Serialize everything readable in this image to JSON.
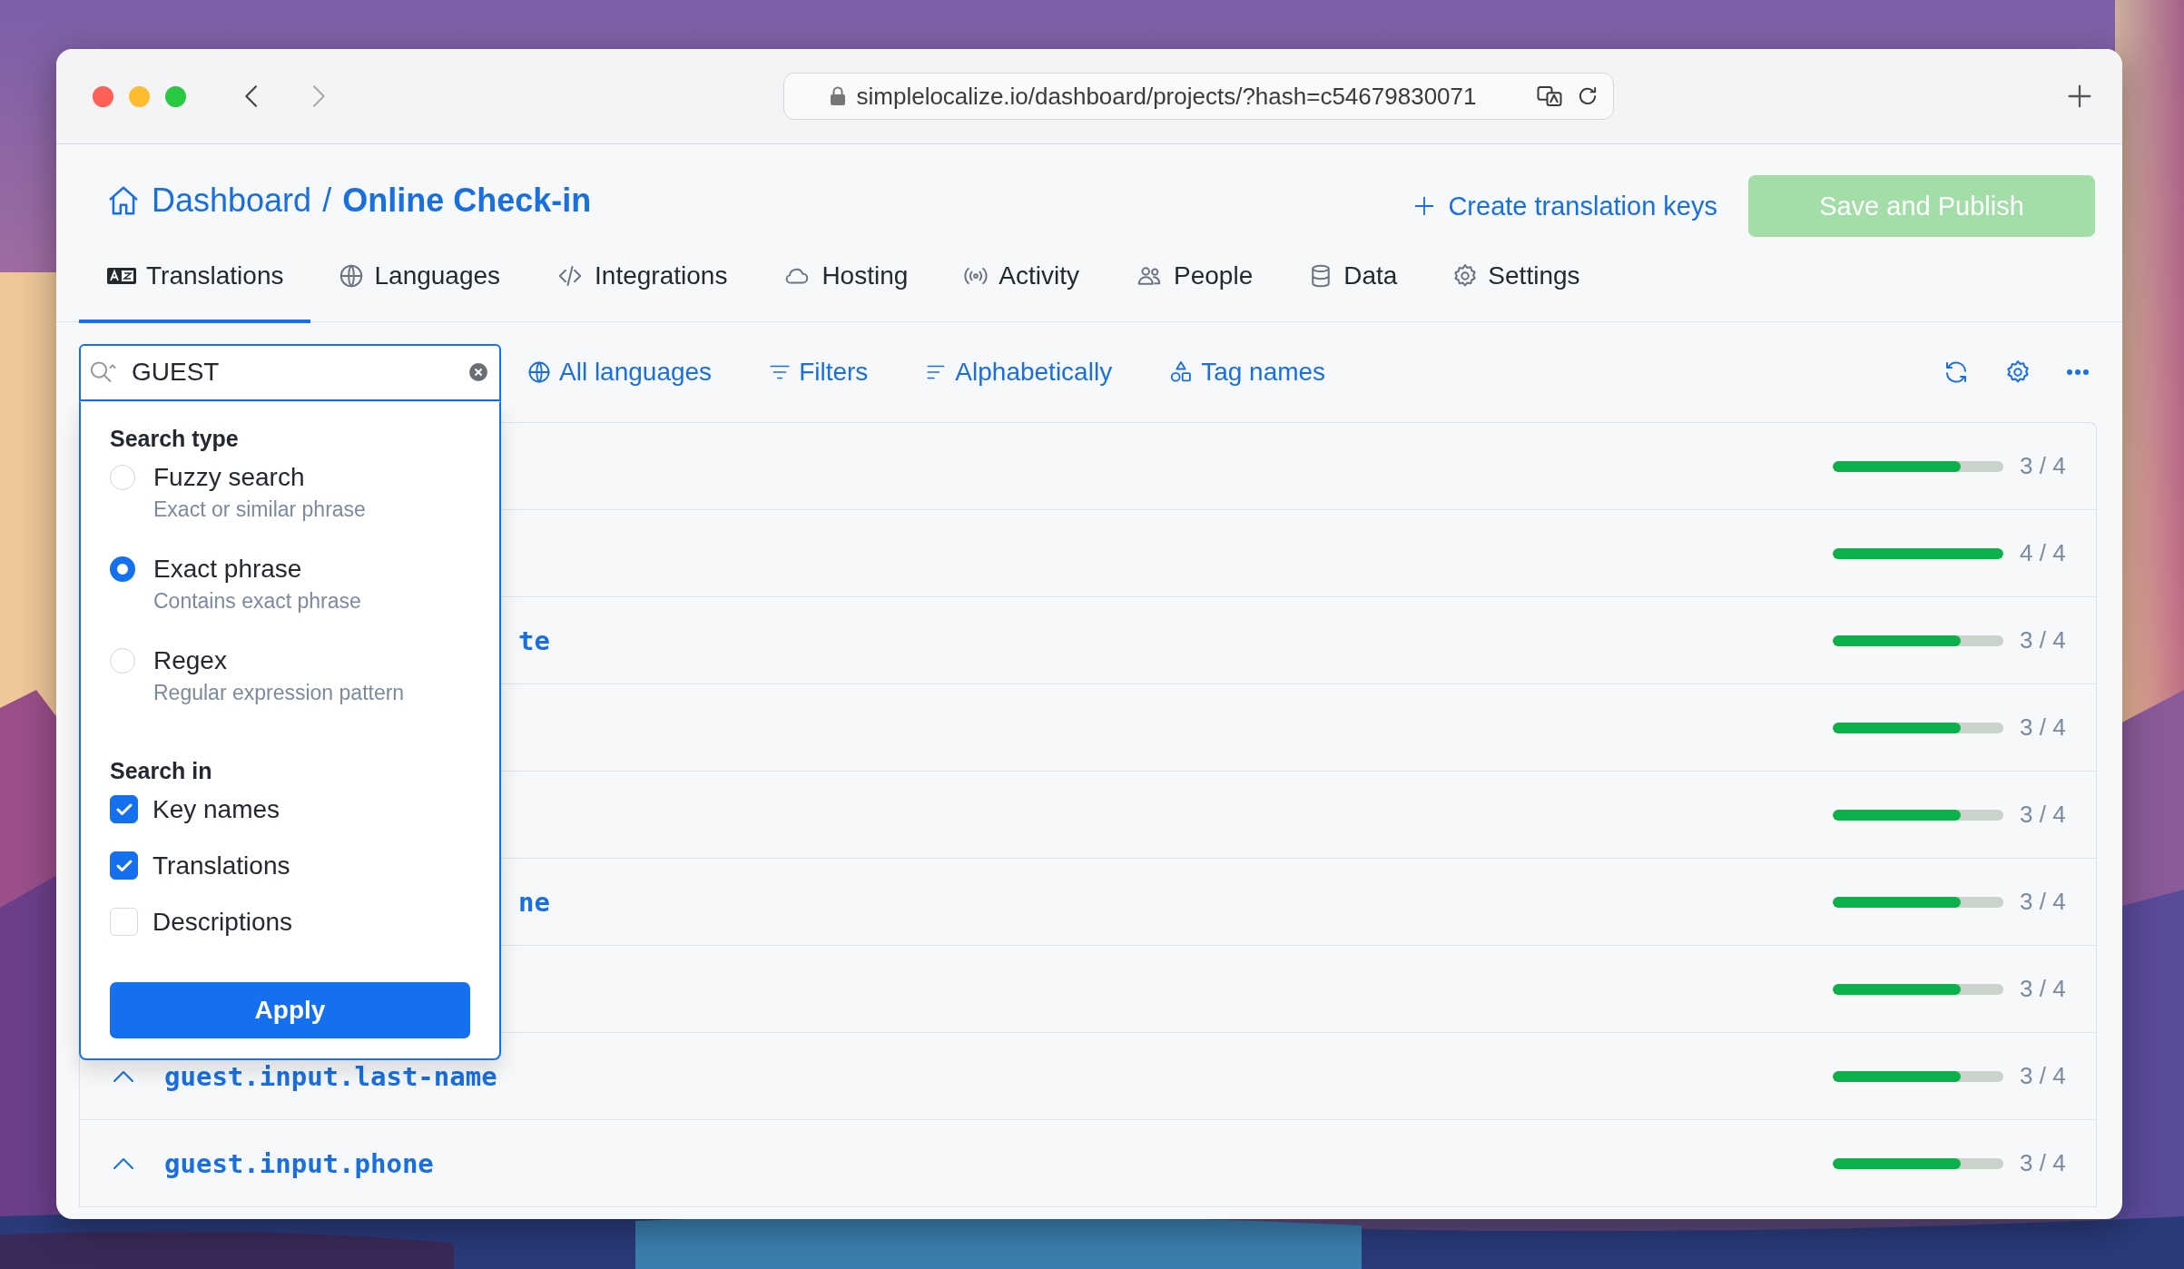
{
  "browser": {
    "url": "simplelocalize.io/dashboard/projects/?hash=c54679830071"
  },
  "breadcrumb": {
    "parent": "Dashboard",
    "separator": "/",
    "current": "Online Check-in"
  },
  "create_button": {
    "label": "Create translation keys"
  },
  "publish_button": {
    "label": "Save and Publish",
    "disabled": true
  },
  "tabs": [
    {
      "label": "Translations",
      "selected": true
    },
    {
      "label": "Languages",
      "selected": false
    },
    {
      "label": "Integrations",
      "selected": false
    },
    {
      "label": "Hosting",
      "selected": false
    },
    {
      "label": "Activity",
      "selected": false
    },
    {
      "label": "People",
      "selected": false
    },
    {
      "label": "Data",
      "selected": false
    },
    {
      "label": "Settings",
      "selected": false
    }
  ],
  "search": {
    "value": "GUEST"
  },
  "toolbar_links": [
    "All languages",
    "Filters",
    "Alphabetically",
    "Tag names"
  ],
  "search_menu": {
    "search_type_title": "Search type",
    "search_types": [
      {
        "label": "Fuzzy search",
        "description": "Exact or similar phrase",
        "selected": false
      },
      {
        "label": "Exact phrase",
        "description": "Contains exact phrase",
        "selected": true
      },
      {
        "label": "Regex",
        "description": "Regular expression pattern",
        "selected": false
      }
    ],
    "search_in_title": "Search in",
    "search_in": [
      {
        "label": "Key names",
        "checked": true
      },
      {
        "label": "Translations",
        "checked": true
      },
      {
        "label": "Descriptions",
        "checked": false
      }
    ],
    "apply": "Apply"
  },
  "rows": [
    {
      "kind": "hidden",
      "level": 0.75,
      "count": "3 / 4"
    },
    {
      "kind": "hidden",
      "level": 1,
      "count": "4 / 4"
    },
    {
      "kind": "cut",
      "key": "te",
      "level": 0.75,
      "count": "3 / 4"
    },
    {
      "kind": "hidden",
      "level": 0.75,
      "count": "3 / 4"
    },
    {
      "kind": "hidden",
      "level": 0.75,
      "count": "3 / 4"
    },
    {
      "kind": "cut",
      "key": "ne",
      "level": 0.75,
      "count": "3 / 4"
    },
    {
      "kind": "hidden",
      "level": 0.75,
      "count": "3 / 4"
    },
    {
      "kind": "full",
      "key": "guest.input.last-name",
      "level": 0.75,
      "count": "3 / 4"
    },
    {
      "kind": "full",
      "key": "guest.input.phone",
      "level": 0.75,
      "count": "3 / 4"
    }
  ]
}
